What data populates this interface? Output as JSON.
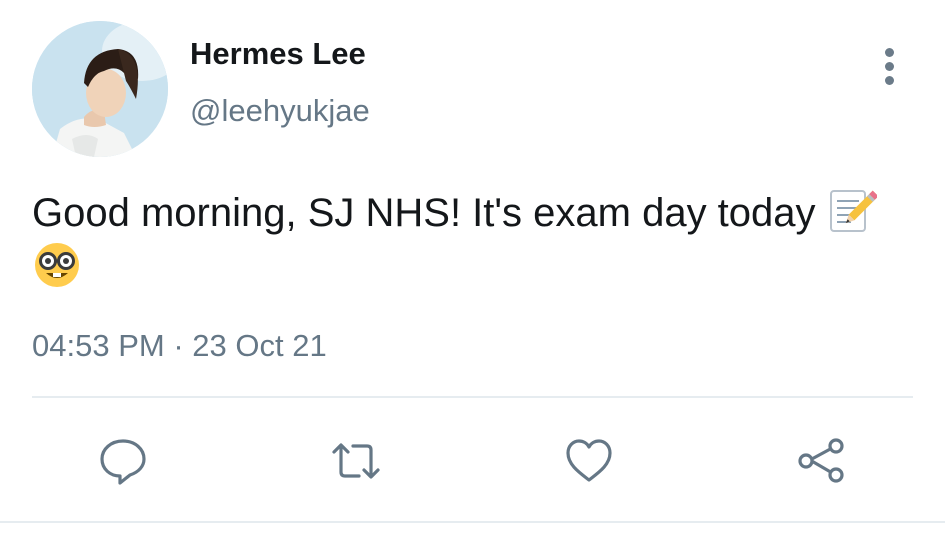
{
  "tweet": {
    "author": {
      "display_name": "Hermes Lee",
      "handle": "@leehyukjae"
    },
    "text": "Good morning, SJ NHS! It's exam day today",
    "emojis": [
      "memo-icon",
      "nerd-face-icon"
    ],
    "time": "04:53 PM",
    "separator": "·",
    "date": "23 Oct 21"
  },
  "actions": {
    "reply": "speech-bubble-icon",
    "retweet": "retweet-arrows-icon",
    "like": "heart-outline-icon",
    "share": "share-nodes-icon"
  },
  "colors": {
    "text_primary": "#14171a",
    "text_secondary": "#657786",
    "icon": "#657786",
    "divider": "#e6ecf0"
  }
}
